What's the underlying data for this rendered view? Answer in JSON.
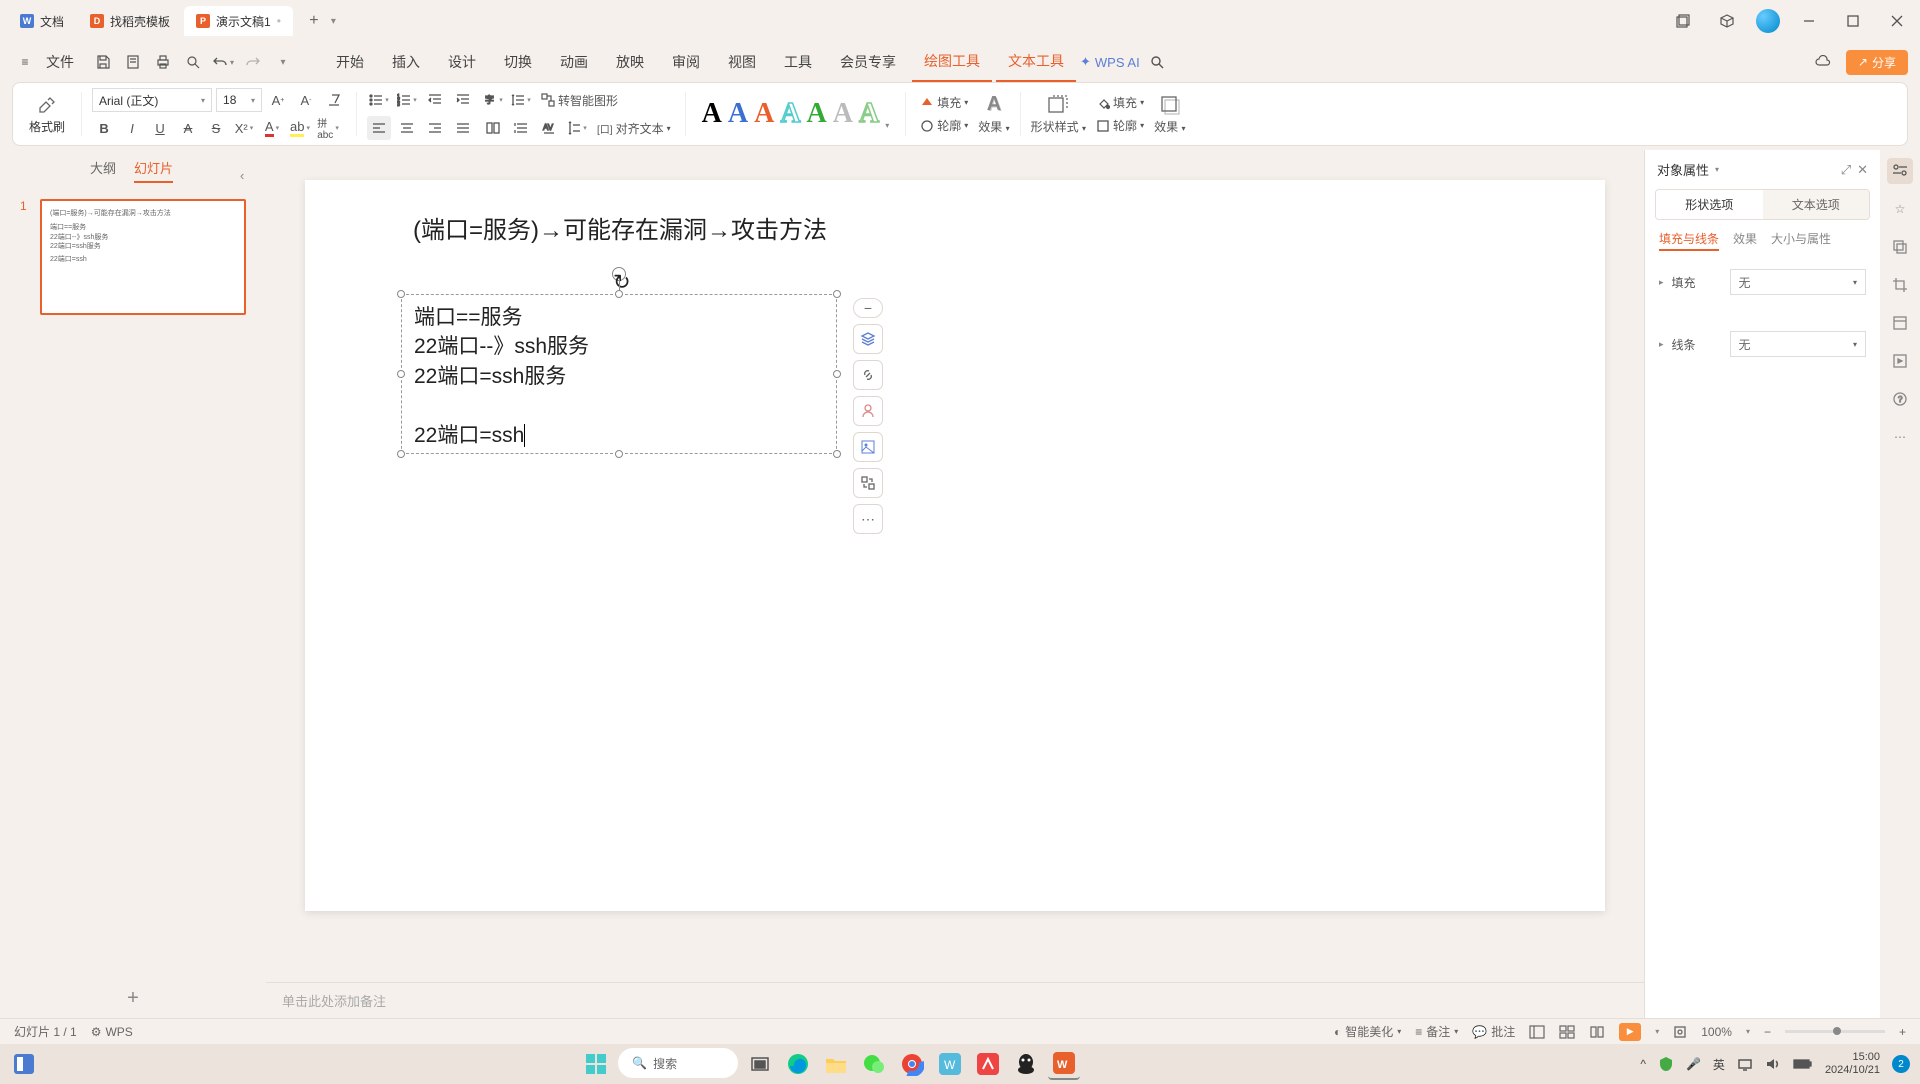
{
  "tabs": [
    {
      "label": "文档",
      "icon": "W",
      "color": "#4a7bd0"
    },
    {
      "label": "找稻壳模板",
      "icon": "D",
      "color": "#e8602c"
    },
    {
      "label": "演示文稿1",
      "icon": "P",
      "color": "#e8602c",
      "active": true,
      "dirty": "•"
    }
  ],
  "menubar": {
    "file": "文件",
    "items": [
      "开始",
      "插入",
      "设计",
      "切换",
      "动画",
      "放映",
      "审阅",
      "视图",
      "工具",
      "会员专享",
      "绘图工具",
      "文本工具"
    ],
    "active": [
      10,
      11
    ],
    "ai": "WPS AI",
    "share": "分享"
  },
  "ribbon": {
    "brush": "格式刷",
    "font_name": "Arial (正文)",
    "font_size": "18",
    "smart_shape": "转智能图形",
    "align_text": "对齐文本",
    "fill": "填充",
    "outline": "轮廓",
    "effect": "效果",
    "shape_style": "形状样式",
    "outline2": "轮廓",
    "effect2": "效果"
  },
  "pane": {
    "outline": "大纲",
    "slides": "幻灯片"
  },
  "slide": {
    "title": "(端口=服务)→可能存在漏洞→攻击方法",
    "body": "端口==服务\n22端口--》ssh服务\n22端口=ssh服务\n\n22端口=ssh"
  },
  "thumb": {
    "l1": "(端口=服务)→可能存在漏洞→攻击方法",
    "l2": "端口==服务",
    "l3": "22端口--》ssh服务",
    "l4": "22端口=ssh服务",
    "l5": "22端口=ssh"
  },
  "notes": "单击此处添加备注",
  "prop": {
    "title": "对象属性",
    "tab1": "形状选项",
    "tab2": "文本选项",
    "sub1": "填充与线条",
    "sub2": "效果",
    "sub3": "大小与属性",
    "fill": "填充",
    "line": "线条",
    "none": "无"
  },
  "status": {
    "slide": "幻灯片 1 / 1",
    "wps": "WPS",
    "beautify": "智能美化",
    "notes": "备注",
    "comment": "批注",
    "zoom": "100%"
  },
  "taskbar": {
    "search": "搜索",
    "ime": "英",
    "time": "15:00",
    "date": "2024/10/21",
    "badge": "2"
  }
}
